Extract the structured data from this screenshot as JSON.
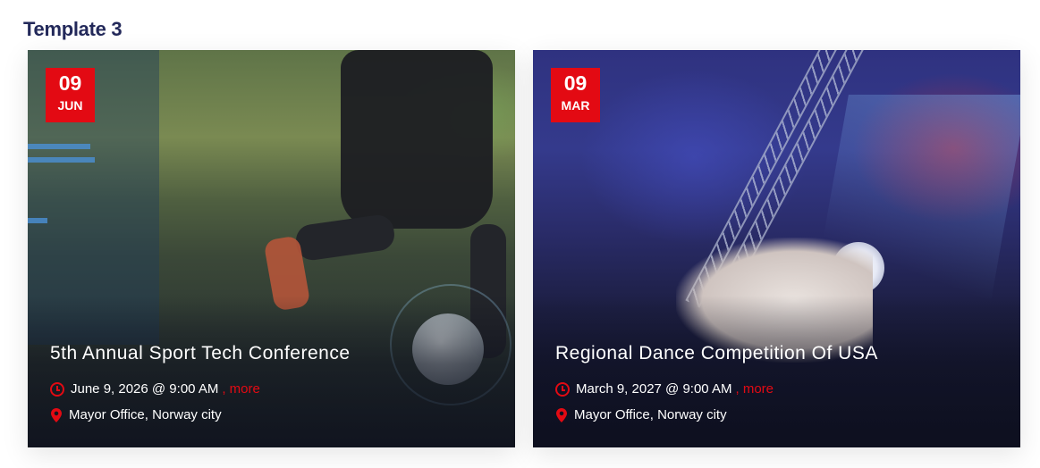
{
  "page": {
    "heading": "Template 3"
  },
  "colors": {
    "accent": "#e30a13",
    "heading": "#23295a"
  },
  "cards": [
    {
      "date_day": "09",
      "date_month": "JUN",
      "title": "5th Annual Sport Tech Conference",
      "datetime": "June 9, 2026 @ 9:00 AM",
      "more_label": ", more",
      "location": "Mayor Office, Norway city",
      "clock_icon": "clock-icon",
      "pin_icon": "map-pin-icon"
    },
    {
      "date_day": "09",
      "date_month": "MAR",
      "title": "Regional Dance Competition Of USA",
      "datetime": "March 9, 2027 @ 9:00 AM",
      "more_label": ", more",
      "location": "Mayor Office, Norway city",
      "clock_icon": "clock-icon",
      "pin_icon": "map-pin-icon"
    }
  ]
}
